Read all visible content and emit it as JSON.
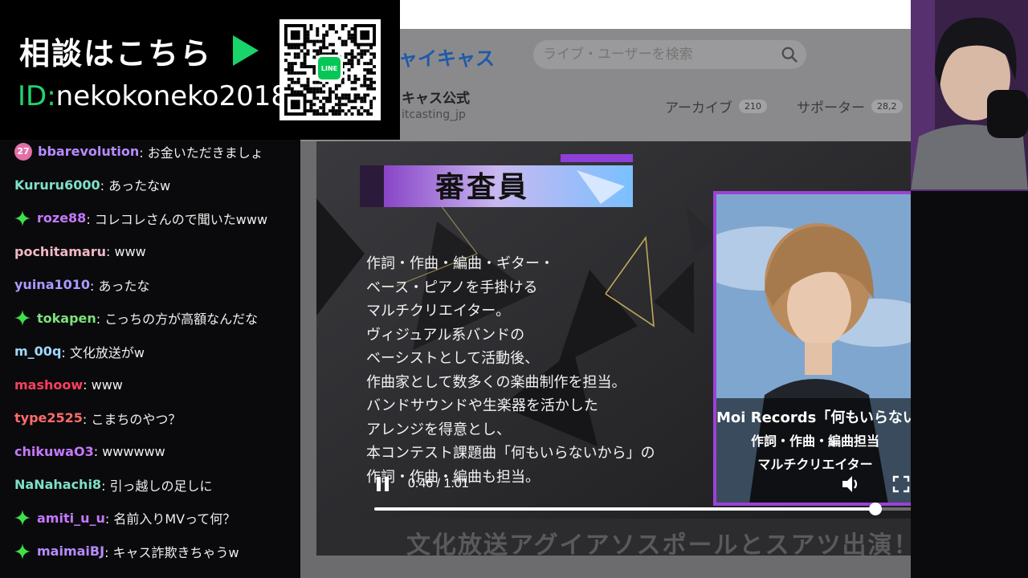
{
  "banner": {
    "title": "相談はこちら",
    "id_prefix": "ID:",
    "id_value": "nekokoneko2018",
    "line_label": "LINE",
    "accent": "#19d36b"
  },
  "chat": {
    "messages": [
      {
        "badge": "27",
        "badge_type": "number",
        "user": "bbarevolution",
        "color": "#b58cff",
        "text": ": お金いただきましょ"
      },
      {
        "badge": "",
        "badge_type": "none",
        "user": "Kururu6000",
        "color": "#7fe0c9",
        "text": ": あったなw"
      },
      {
        "badge": "",
        "badge_type": "star",
        "user": "roze88",
        "color": "#c678ff",
        "text": ": コレコレさんので聞いたwww"
      },
      {
        "badge": "",
        "badge_type": "none",
        "user": "pochitamaru",
        "color": "#f0b8c8",
        "text": ": www"
      },
      {
        "badge": "",
        "badge_type": "none",
        "user": "yuina1010",
        "color": "#a89cff",
        "text": ": あったな"
      },
      {
        "badge": "",
        "badge_type": "star",
        "user": "tokapen",
        "color": "#7ce27a",
        "text": ": こっちの方が高額なんだな"
      },
      {
        "badge": "",
        "badge_type": "none",
        "user": "m_00q",
        "color": "#9fd8ff",
        "text": ": 文化放送がw"
      },
      {
        "badge": "",
        "badge_type": "none",
        "user": "mashoow",
        "color": "#ff3f5e",
        "text": ": www"
      },
      {
        "badge": "",
        "badge_type": "none",
        "user": "type2525",
        "color": "#ff6b6b",
        "text": ": こまちのやつ？"
      },
      {
        "badge": "",
        "badge_type": "none",
        "user": "chikuwaO3",
        "color": "#c678ff",
        "text": ": wwwwww"
      },
      {
        "badge": "",
        "badge_type": "none",
        "user": "NaNahachi8",
        "color": "#7fe0c9",
        "text": ": 引っ越しの足しに"
      },
      {
        "badge": "",
        "badge_type": "star",
        "user": "amiti_u_u",
        "color": "#c678ff",
        "text": ": 名前入りMVって何？"
      },
      {
        "badge": "",
        "badge_type": "star",
        "user": "maimaiBJ",
        "color": "#b58cff",
        "text": ": キャス詐欺きちゃうw"
      }
    ]
  },
  "browser": {
    "site_logo": "ャイキャス",
    "search_placeholder": "ライブ・ユーザーを検索",
    "channel_name": "キャス公式",
    "channel_handle": "itcasting_jp",
    "tabs": [
      {
        "label": "アーカイブ",
        "count": "210"
      },
      {
        "label": "サポーター",
        "count": "28,2"
      }
    ]
  },
  "video": {
    "judge_title": "審査員",
    "description": [
      "作詞・作曲・編曲・ギター・",
      "ベース・ピアノを手掛ける",
      "マルチクリエイター。",
      "ヴィジュアル系バンドの",
      "ベーシストとして活動後、",
      "作曲家として数多くの楽曲制作を担当。",
      "バンドサウンドや生楽器を活かした",
      "アレンジを得意とし、",
      "本コンテスト課題曲「何もいらないから」の",
      "作詞・作曲・編曲も担当。"
    ],
    "profile_caption": [
      "Moi Records「何もいらないから」",
      "作詞・作曲・編曲担当",
      "マルチクリエイター"
    ],
    "time_readout": "0:46 / 1:01",
    "progress": 0.8,
    "bottom_text": "文化放送アグイアソスポールとスアツ出演！",
    "frame_accent": "#9b42d6"
  }
}
